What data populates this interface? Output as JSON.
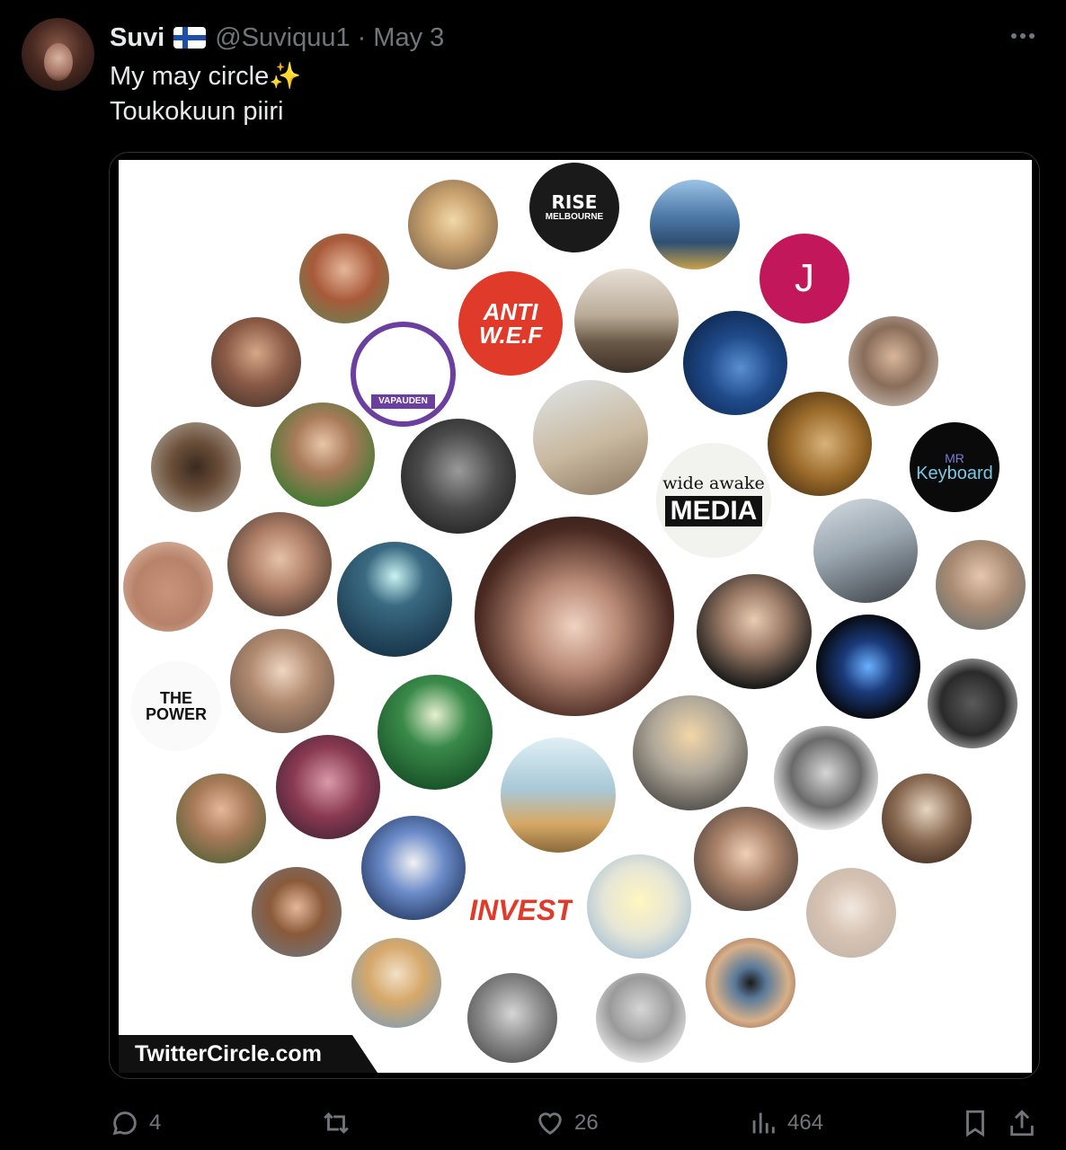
{
  "tweet": {
    "author_name": "Suvi",
    "handle": "@Suviquu1",
    "separator": "·",
    "date": "May 3",
    "line1": "My may circle",
    "line1_emoji": "✨",
    "line2": "Toukokuun piiri"
  },
  "image": {
    "watermark": "TwitterCircle.com",
    "labels": {
      "rise_top": "RISE",
      "rise_bottom": "MELBOURNE",
      "anti_top": "ANTI",
      "anti_bottom": "W.E.F",
      "j": "J",
      "wide_awake": "wide awake",
      "media": "MEDIA",
      "mr_keyboard_top": "MR",
      "mr_keyboard_bottom": "Keyboard",
      "vapauden": "VAPAUDEN",
      "the_power_top": "THE",
      "the_power_bottom": "POWER",
      "invest": "INVEST"
    }
  },
  "actions": {
    "replies": "4",
    "retweets": "",
    "likes": "26",
    "views": "464"
  },
  "icons": [
    "more-icon",
    "flag-icon",
    "reply-icon",
    "retweet-icon",
    "like-icon",
    "views-icon",
    "bookmark-icon",
    "share-icon"
  ],
  "colors": {
    "background": "#000000",
    "text": "#e7e9ea",
    "muted": "#71767b",
    "anti_wef_red": "#e03a2a",
    "j_pink": "#c2185b"
  }
}
